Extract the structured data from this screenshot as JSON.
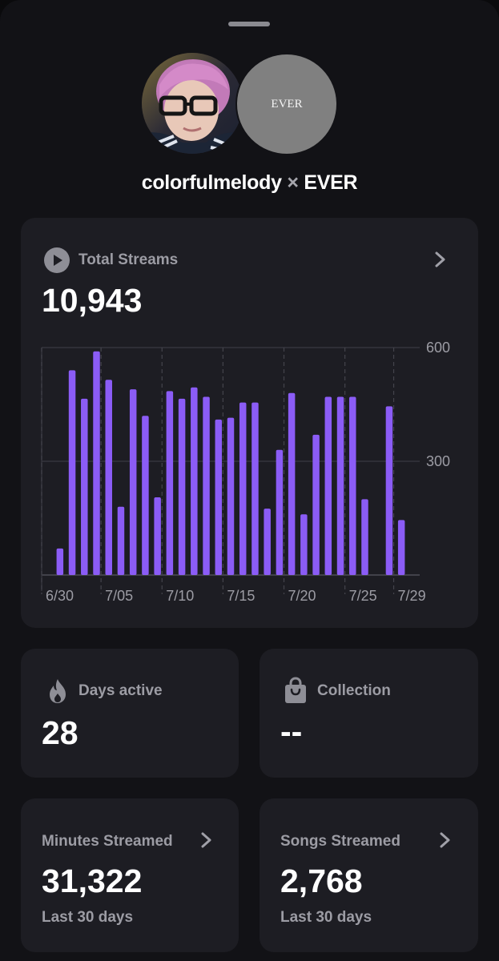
{
  "header": {
    "user_name": "colorfulmelody",
    "separator": "×",
    "artist_name": "EVER",
    "artist_avatar_text": "EVER"
  },
  "total_streams": {
    "label": "Total Streams",
    "value": "10,943",
    "icon": "play-circle-icon"
  },
  "chart_data": {
    "type": "bar",
    "title": "",
    "xlabel": "",
    "ylabel": "",
    "ylim": [
      0,
      600
    ],
    "y_ticks": [
      "600",
      "300"
    ],
    "x_tick_labels": [
      "6/30",
      "7/05",
      "7/10",
      "7/15",
      "7/20",
      "7/25",
      "7/29"
    ],
    "x_tick_day_index": [
      0,
      5,
      10,
      15,
      20,
      25,
      29
    ],
    "categories": [
      "6/30",
      "7/01",
      "7/02",
      "7/03",
      "7/04",
      "7/05",
      "7/06",
      "7/07",
      "7/08",
      "7/09",
      "7/10",
      "7/11",
      "7/12",
      "7/13",
      "7/14",
      "7/15",
      "7/16",
      "7/17",
      "7/18",
      "7/19",
      "7/20",
      "7/21",
      "7/22",
      "7/23",
      "7/24",
      "7/25",
      "7/26",
      "7/27",
      "7/28",
      "7/29",
      "7/30"
    ],
    "values": [
      0,
      70,
      540,
      465,
      590,
      515,
      180,
      490,
      420,
      205,
      485,
      465,
      495,
      470,
      410,
      415,
      455,
      455,
      175,
      330,
      480,
      160,
      370,
      470,
      470,
      470,
      200,
      0,
      445,
      145,
      0
    ],
    "grid": true,
    "color": "#8b5cf6"
  },
  "days_active": {
    "label": "Days active",
    "value": "28",
    "icon": "flame-icon"
  },
  "collection": {
    "label": "Collection",
    "value": "--",
    "icon": "shopping-bag-icon"
  },
  "minutes_streamed": {
    "label": "Minutes Streamed",
    "value": "31,322",
    "sub": "Last 30 days"
  },
  "songs_streamed": {
    "label": "Songs Streamed",
    "value": "2,768",
    "sub": "Last 30 days"
  },
  "colors": {
    "background": "#121216",
    "card": "#1d1d23",
    "accent": "#8b5cf6",
    "muted_text": "#9c9ca4"
  }
}
